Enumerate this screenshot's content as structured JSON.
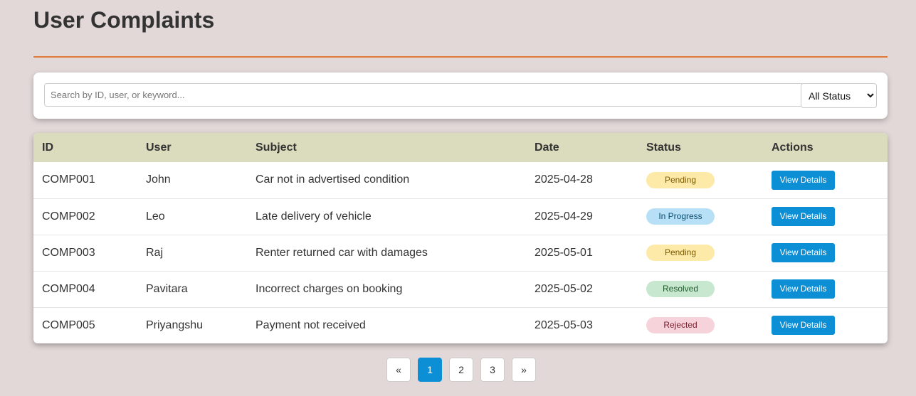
{
  "page": {
    "title": "User Complaints"
  },
  "colors": {
    "accent": "#e07a3a",
    "primary": "#0d8fd6",
    "header_bg": "#dbdbbd",
    "page_bg": "#e2d8d8"
  },
  "filters": {
    "search_placeholder": "Search by ID, user, or keyword...",
    "status_options": [
      "All Status"
    ],
    "status_selected": "All Status"
  },
  "table": {
    "headers": [
      "ID",
      "User",
      "Subject",
      "Date",
      "Status",
      "Actions"
    ],
    "rows": [
      {
        "id": "COMP001",
        "user": "John",
        "subject": "Car not in advertised condition",
        "date": "2025-04-28",
        "status": "Pending",
        "status_bg": "#fde9a8",
        "status_color": "#7a5a00",
        "action": "View Details"
      },
      {
        "id": "COMP002",
        "user": "Leo",
        "subject": "Late delivery of vehicle",
        "date": "2025-04-29",
        "status": "In Progress",
        "status_bg": "#b7e0f7",
        "status_color": "#0b4d70",
        "action": "View Details"
      },
      {
        "id": "COMP003",
        "user": "Raj",
        "subject": "Renter returned car with damages",
        "date": "2025-05-01",
        "status": "Pending",
        "status_bg": "#fde9a8",
        "status_color": "#7a5a00",
        "action": "View Details"
      },
      {
        "id": "COMP004",
        "user": "Pavitara",
        "subject": "Incorrect charges on booking",
        "date": "2025-05-02",
        "status": "Resolved",
        "status_bg": "#c7e7ce",
        "status_color": "#1e5a2a",
        "action": "View Details"
      },
      {
        "id": "COMP005",
        "user": "Priyangshu",
        "subject": "Payment not received",
        "date": "2025-05-03",
        "status": "Rejected",
        "status_bg": "#f6d3da",
        "status_color": "#7a1e2c",
        "action": "View Details"
      }
    ]
  },
  "pagination": {
    "prev": "«",
    "pages": [
      "1",
      "2",
      "3"
    ],
    "current": "1",
    "next": "»"
  }
}
